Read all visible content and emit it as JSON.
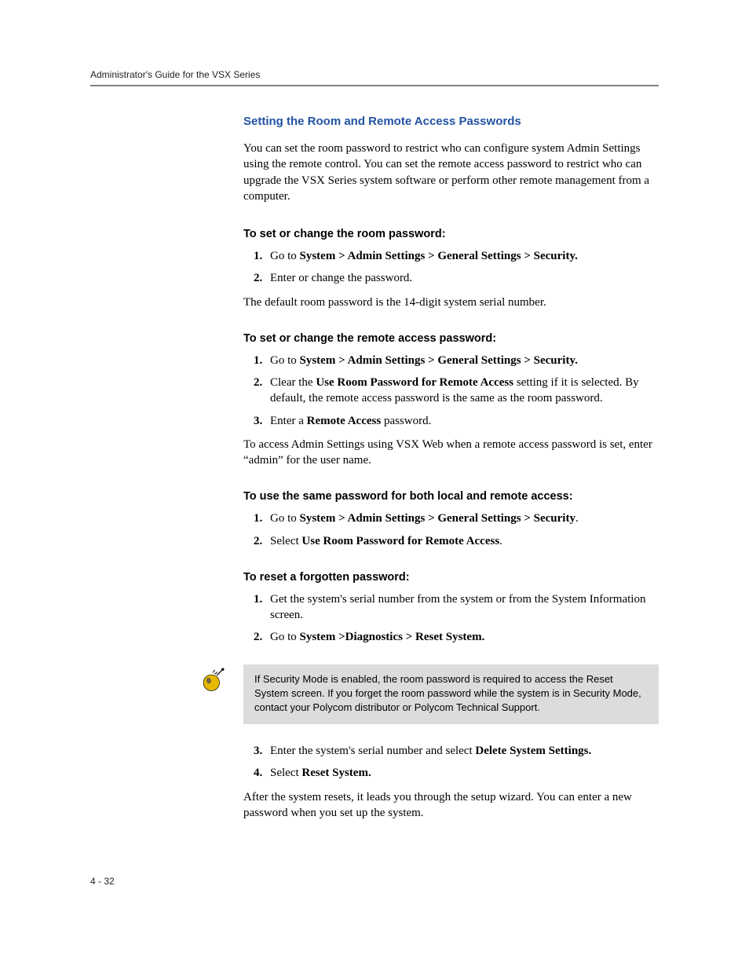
{
  "header": {
    "running": "Administrator's Guide for the VSX Series"
  },
  "section": {
    "title": "Setting the Room and Remote Access Passwords",
    "intro": "You can set the room password to restrict who can configure system Admin Settings using the remote control. You can set the remote access password to restrict who can upgrade the VSX Series system software or perform other remote management from a computer."
  },
  "proc1": {
    "title": "To set or change the room password:",
    "step1_pre": "Go to ",
    "step1_bold": "System > Admin Settings > General Settings > Security.",
    "step2": "Enter or change the password.",
    "after": "The default room password is the 14-digit system serial number."
  },
  "proc2": {
    "title": "To set or change the remote access password:",
    "step1_pre": "Go to ",
    "step1_bold": "System > Admin Settings > General Settings > Security.",
    "step2_pre": "Clear the ",
    "step2_bold": "Use Room Password for Remote Access",
    "step2_post": " setting if it is selected. By default, the remote access password is the same as the room password.",
    "step3_pre": "Enter a ",
    "step3_bold": "Remote Access",
    "step3_post": " password.",
    "after": "To access Admin Settings using VSX Web when a remote access password is set, enter “admin” for the user name."
  },
  "proc3": {
    "title": "To use the same password for both local and remote access:",
    "step1_pre": "Go to ",
    "step1_bold": "System > Admin Settings > General Settings > Security",
    "step1_post": ".",
    "step2_pre": "Select ",
    "step2_bold": "Use Room Password for Remote Access",
    "step2_post": "."
  },
  "proc4": {
    "title": "To reset a forgotten password:",
    "step1": "Get the system's serial number from the system or from the System Information screen.",
    "step2_pre": "Go to ",
    "step2_bold": "System >Diagnostics > Reset System.",
    "note": "If Security Mode is enabled, the room password is required to access the Reset System screen. If you forget the room password while the system is in Security Mode, contact your Polycom distributor or Polycom Technical Support.",
    "step3_pre": "Enter the system's serial number and select ",
    "step3_bold": "Delete System Settings.",
    "step4_pre": "Select ",
    "step4_bold": "Reset System.",
    "after": "After the system resets, it leads you through the setup wizard. You can enter a new password when you set up the system."
  },
  "footer": {
    "pagenum": "4 - 32"
  }
}
